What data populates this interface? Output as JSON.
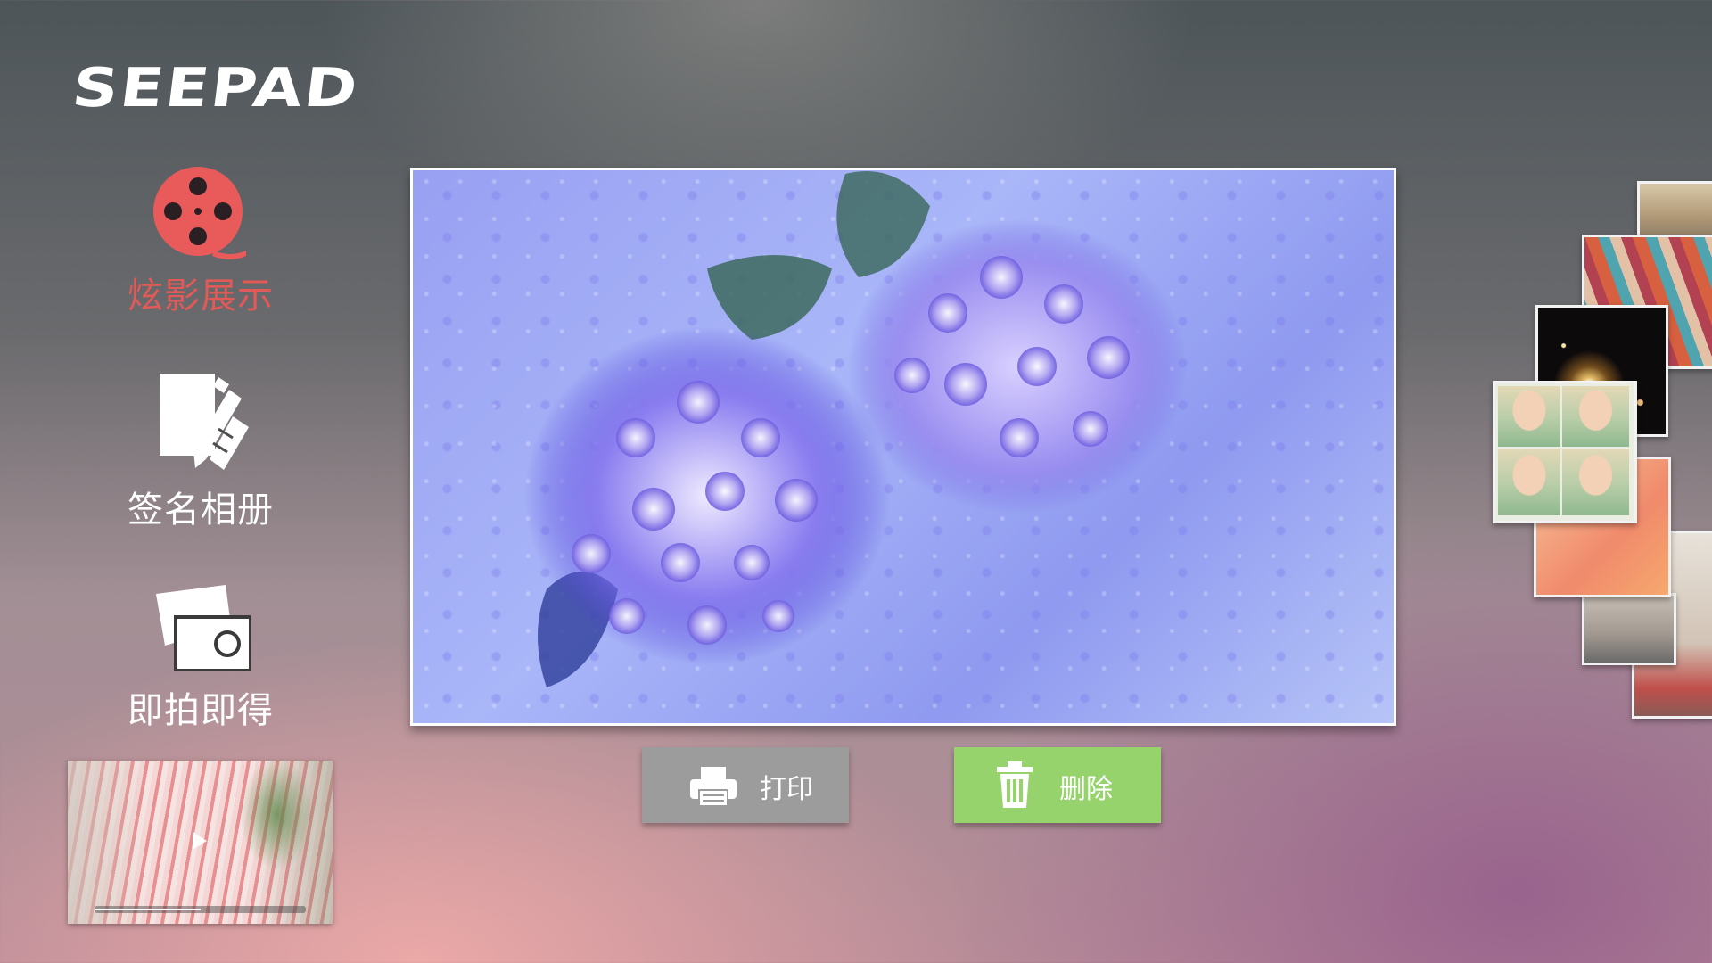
{
  "brand": {
    "logo_text": "SEEPAD"
  },
  "sidebar": {
    "items": [
      {
        "label": "炫影展示",
        "icon": "film-reel-icon",
        "active": true,
        "color": "#e25a57"
      },
      {
        "label": "签名相册",
        "icon": "signature-album-icon",
        "active": false,
        "color": "#ffffff"
      },
      {
        "label": "即拍即得",
        "icon": "camera-photos-icon",
        "active": false,
        "color": "#ffffff"
      }
    ],
    "video_thumbnail": {
      "icon": "play-icon",
      "progress_fraction": 0.5
    }
  },
  "viewer": {
    "image_subject": "hydrangea-photo"
  },
  "actions": {
    "print": {
      "label": "打印",
      "icon": "printer-icon",
      "color": "#9c9c9c"
    },
    "delete": {
      "label": "删除",
      "icon": "trash-icon",
      "color": "#96d36c"
    }
  },
  "gallery_stack": {
    "count": 7
  }
}
